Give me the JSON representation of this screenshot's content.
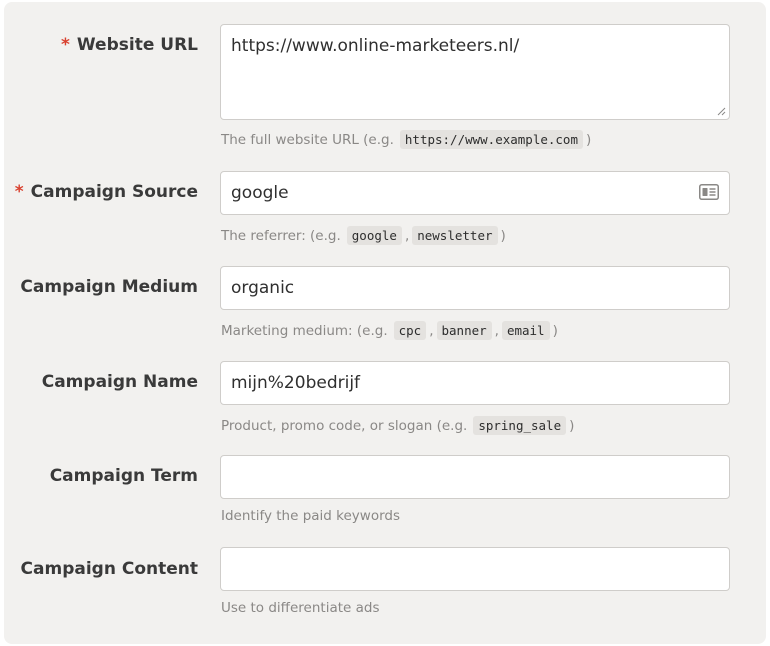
{
  "fields": {
    "website_url": {
      "label": "Website URL",
      "required_mark": "*",
      "value": "https://www.online-marketeers.nl/",
      "hint_prefix": "The full website URL (e.g.",
      "hint_codes": [
        "https://www.example.com"
      ],
      "hint_suffix": ")"
    },
    "campaign_source": {
      "label": "Campaign Source",
      "required_mark": "*",
      "value": "google",
      "hint_prefix": "The referrer: (e.g.",
      "hint_codes": [
        "google",
        "newsletter"
      ],
      "hint_suffix": ")",
      "icon": "contact-card-icon"
    },
    "campaign_medium": {
      "label": "Campaign Medium",
      "value": "organic",
      "hint_prefix": "Marketing medium: (e.g.",
      "hint_codes": [
        "cpc",
        "banner",
        "email"
      ],
      "hint_suffix": ")"
    },
    "campaign_name": {
      "label": "Campaign Name",
      "value": "mijn%20bedrijf",
      "hint_prefix": "Product, promo code, or slogan (e.g.",
      "hint_codes": [
        "spring_sale"
      ],
      "hint_suffix": ")"
    },
    "campaign_term": {
      "label": "Campaign Term",
      "value": "",
      "hint": "Identify the paid keywords"
    },
    "campaign_content": {
      "label": "Campaign Content",
      "value": "",
      "hint": "Use to differentiate ads"
    }
  },
  "colors": {
    "panel_bg": "#f2f1ef",
    "required": "#d9412f",
    "label": "#3a3a3a",
    "hint": "#8a8886",
    "code_bg": "#e4e2df"
  }
}
